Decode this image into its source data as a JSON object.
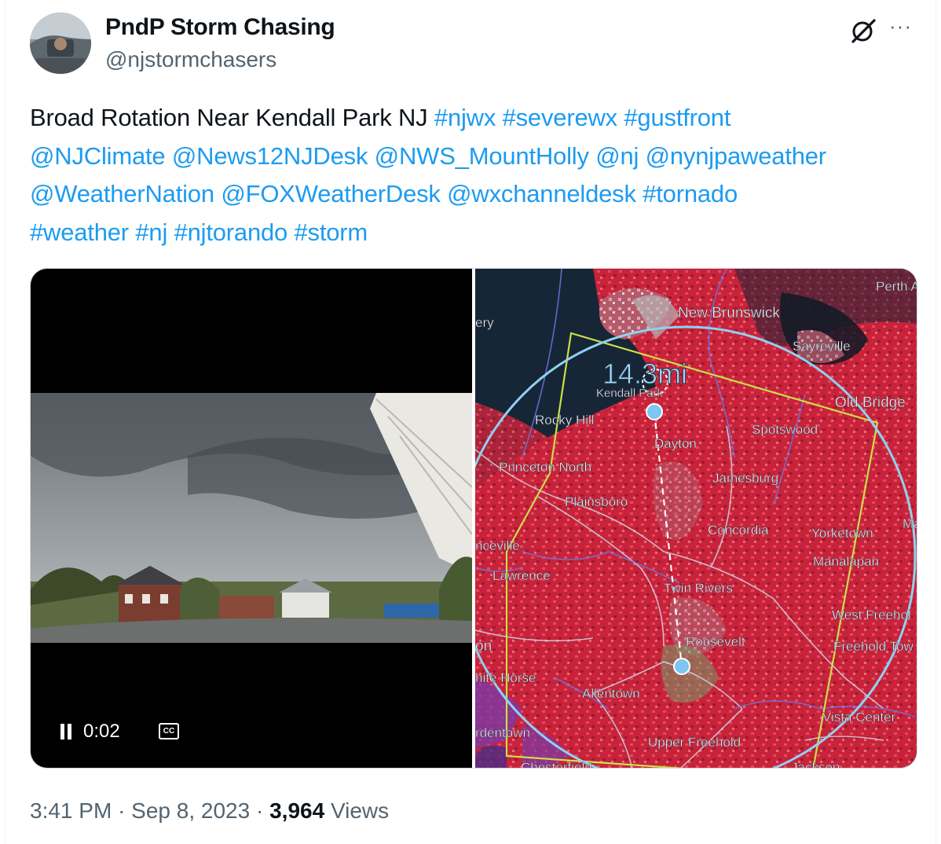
{
  "author": {
    "display_name": "PndP Storm Chasing",
    "handle": "@njstormchasers"
  },
  "header_icons": [
    "grok-icon",
    "more-options-icon"
  ],
  "more_label": "···",
  "tweet": {
    "plain": "Broad Rotation Near Kendall Park NJ ",
    "line1_links": [
      "#njwx",
      "#severewx",
      "#gustfront"
    ],
    "line2_links": [
      "@NJClimate",
      "@News12NJDesk",
      "@NWS_MountHolly",
      "@nj",
      "@nynjpaweather"
    ],
    "line3_links": [
      "@WeatherNation",
      "@FOXWeatherDesk",
      "@wxchanneldesk",
      "#tornado"
    ],
    "line4_links": [
      "#weather",
      "#nj",
      "#njtorando",
      "#storm"
    ]
  },
  "video": {
    "time": "0:02",
    "cc_label": "CC"
  },
  "radar": {
    "distance_label": "14.3mi",
    "places": {
      "perth": "Perth A",
      "new_brunswick": "New Brunswick",
      "ery": "ery",
      "sayreville": "Sayreville",
      "kendall": "Kendall Park",
      "old_bridge": "Old Bridge",
      "rocky_hill": "Rocky Hill",
      "spotswood": "Spotswood",
      "dayton": "Dayton",
      "princeton_north": "Princeton North",
      "jamesburg": "Jamesburg",
      "plainsboro": "Plainsboro",
      "ma": "Ma",
      "concordia": "Concordia",
      "yorketown": "Yorketown",
      "nceville": "nceville",
      "manalapan": "Manalapan",
      "lawrence": "Lawrence",
      "twin_rivers": "Twin Rivers",
      "west_freehold": "West Freehol",
      "roosevelt": "Roosevelt",
      "on": "on",
      "freehold_town": "Freehold Tow",
      "white_horse": "hite Horse",
      "allentown": "Allentown",
      "vista_center": "Vista Center",
      "rdentown": "rdentown",
      "upper_freehold": "Upper Freehold",
      "chesterfield": "Chesterfield",
      "jackson": "Jackson"
    }
  },
  "footer": {
    "time": "3:41 PM",
    "sep": "·",
    "date": "Sep 8, 2023",
    "views_count": "3,964",
    "views_label": "Views"
  }
}
